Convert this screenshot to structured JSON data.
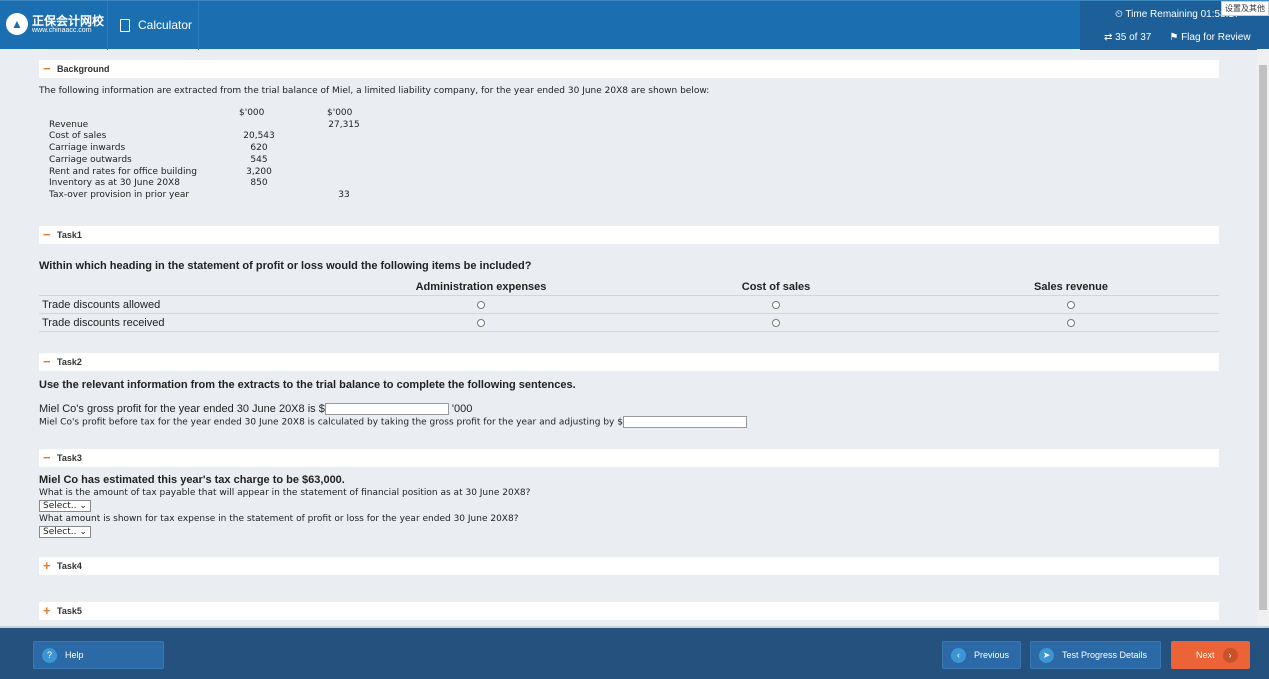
{
  "header": {
    "logo_cn": "正保会计网校",
    "logo_url": "www.chinaacc.com",
    "calculator": "Calculator",
    "time_remaining": "Time Remaining 01:58:17",
    "progress": "35 of 37",
    "flag": "Flag for Review",
    "tooltip": "设置及其他"
  },
  "background": {
    "title": "Background",
    "intro": "The following information are extracted from the trial balance of Miel, a limited liability company, for the year ended 30 June 20X8 are shown below:",
    "col1": "$'000",
    "col2": "$'000",
    "rows": [
      {
        "label": "Revenue",
        "c1": "",
        "c2": "27,315"
      },
      {
        "label": "Cost of sales",
        "c1": "20,543",
        "c2": ""
      },
      {
        "label": "Carriage inwards",
        "c1": "620",
        "c2": ""
      },
      {
        "label": "Carriage outwards",
        "c1": "545",
        "c2": ""
      },
      {
        "label": "Rent and rates for office building",
        "c1": "3,200",
        "c2": ""
      },
      {
        "label": "Inventory as at 30 June 20X8",
        "c1": "850",
        "c2": ""
      },
      {
        "label": "Tax-over provision in prior year",
        "c1": "",
        "c2": "33"
      }
    ]
  },
  "task1": {
    "title": "Task1",
    "question": "Within which heading in the statement of profit or loss would the following items be included?",
    "columns": [
      "Administration expenses",
      "Cost of sales",
      "Sales revenue"
    ],
    "rows": [
      "Trade discounts allowed",
      "Trade discounts received"
    ]
  },
  "task2": {
    "title": "Task2",
    "question": "Use the relevant information from the extracts to the trial balance to complete the following sentences.",
    "s1": "Miel Co's gross profit for the year ended 30 June 20X8 is $",
    "s1_suffix": "'000",
    "s2": "Miel Co's profit before tax for the year ended 30 June 20X8 is calculated by taking the gross profit for the year and adjusting by $"
  },
  "task3": {
    "title": "Task3",
    "heading": "Miel Co has estimated this year's tax charge to be $63,000.",
    "q1": "What is the amount of tax payable that will appear in the statement of financial position as at 30 June 20X8?",
    "q2": "What amount is shown for tax expense in the statement of profit or loss for the year ended 30 June 20X8?",
    "select": "Select.."
  },
  "task4": {
    "title": "Task4"
  },
  "task5": {
    "title": "Task5"
  },
  "footer": {
    "help": "Help",
    "previous": "Previous",
    "progress": "Test Progress Details",
    "next": "Next"
  }
}
